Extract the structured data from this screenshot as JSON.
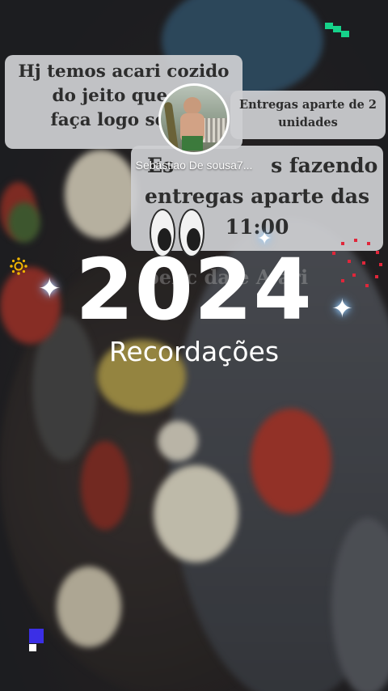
{
  "story": {
    "username": "Sebastiao De sousa7...",
    "bubbles": {
      "first": [
        "Hj temos acari cozido",
        "do jeito que vo",
        "faça logo seu p"
      ],
      "second": [
        "Entregas aparte de 2",
        "unidades"
      ],
      "third": [
        "Es",
        "s fazendo",
        "entregas aparte das",
        "11:00"
      ]
    },
    "watermark": "penc  da  e A  ari",
    "year": "2024",
    "subtitle": "Recordações"
  },
  "icons": {
    "eyes": "eyes-emoji-icon",
    "sparkle": "sparkle-icon",
    "sun": "sun-icon",
    "dotted_circle": "dotted-circle-icon",
    "pixel_top": "pixel-glyph-icon",
    "pixel_bottom": "pixel-glyph-icon"
  },
  "colors": {
    "bubble": "#cdcfd2",
    "text_dark": "#2d2d2d",
    "accent_green": "#16d28a",
    "accent_red": "#e0263a",
    "accent_gold": "#f0b400",
    "accent_purple": "#3b2fe6"
  }
}
